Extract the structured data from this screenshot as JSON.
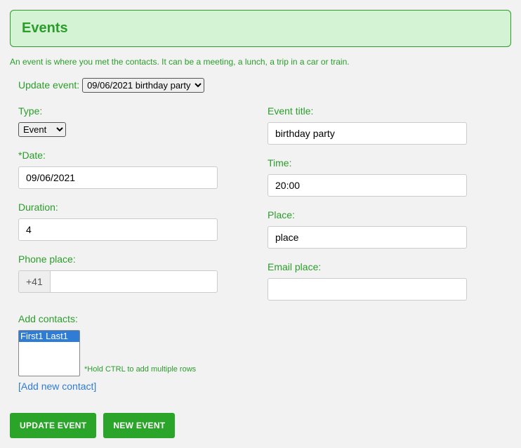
{
  "heading": "Events",
  "description": "An event is where you met the contacts. It can be a meeting, a lunch, a trip in a car or train.",
  "update_label": "Update event:",
  "update_options": [
    "09/06/2021 birthday party"
  ],
  "update_selected": "09/06/2021 birthday party",
  "left": {
    "type_label": "Type:",
    "type_options": [
      "Event"
    ],
    "type_selected": "Event",
    "date_label": "Date:",
    "date_value": "09/06/2021",
    "duration_label": "Duration:",
    "duration_value": "4",
    "phone_label": "Phone place:",
    "phone_prefix": "+41",
    "phone_value": ""
  },
  "right": {
    "title_label": "Event title:",
    "title_value": "birthday party",
    "time_label": "Time:",
    "time_value": "20:00",
    "place_label": "Place:",
    "place_value": "place",
    "email_label": "Email place:",
    "email_value": ""
  },
  "contacts": {
    "label": "Add contacts:",
    "options": [
      "First1 Last1"
    ],
    "hint": "*Hold CTRL to add multiple rows",
    "add_link": "[Add new contact]"
  },
  "buttons": {
    "update": "UPDATE EVENT",
    "new": "NEW EVENT"
  }
}
